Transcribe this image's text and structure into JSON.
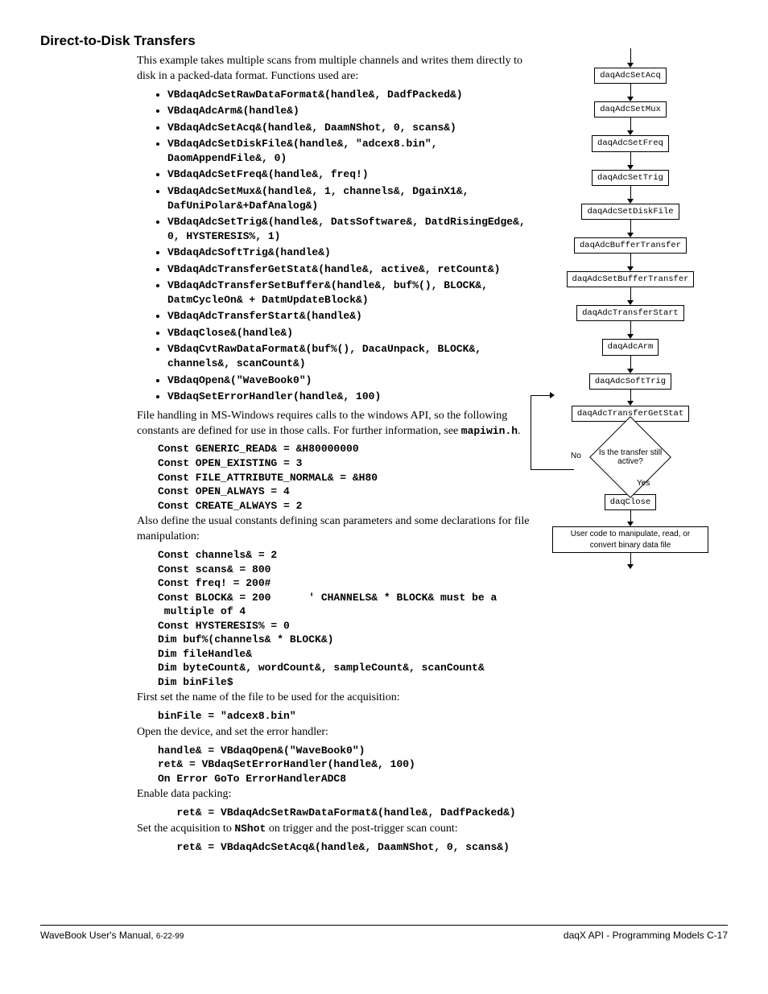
{
  "section_title": "Direct-to-Disk Transfers",
  "intro": "This example takes multiple scans from multiple channels and writes them directly to disk in a packed-data format.  Functions used are:",
  "functions": [
    "VBdaqAdcSetRawDataFormat&(handle&, DadfPacked&)",
    "VBdaqAdcArm&(handle&)",
    "VBdaqAdcSetAcq&(handle&, DaamNShot, 0, scans&)",
    "VBdaqAdcSetDiskFile&(handle&, \"adcex8.bin\", DaomAppendFile&, 0)",
    "VBdaqAdcSetFreq&(handle&, freq!)",
    "VBdaqAdcSetMux&(handle&, 1, channels&, DgainX1&, DafUniPolar&+DafAnalog&)",
    "VBdaqAdcSetTrig&(handle&, DatsSoftware&, DatdRisingEdge&, 0, HYSTERESIS%, 1)",
    "VBdaqAdcSoftTrig&(handle&)",
    "VBdaqAdcTransferGetStat&(handle&, active&, retCount&)",
    "VBdaqAdcTransferSetBuffer&(handle&, buf%(), BLOCK&, DatmCycleOn& + DatmUpdateBlock&)",
    "VBdaqAdcTransferStart&(handle&)",
    "VBdaqClose&(handle&)",
    "VBdaqCvtRawDataFormat&(buf%(), DacaUnpack, BLOCK&, channels&, scanCount&)",
    "VBdaqOpen&(\"WaveBook0\")",
    "VBdaqSetErrorHandler(handle&, 100)"
  ],
  "para_filehandling_a": "File handling in MS-Windows requires calls to the windows API, so the following constants are defined for use in those calls.  For further information, see ",
  "mapiwin": "mapiwin.h",
  "code_consts1": "Const GENERIC_READ& = &H80000000\nConst OPEN_EXISTING = 3\nConst FILE_ATTRIBUTE_NORMAL& = &H80\nConst OPEN_ALWAYS = 4\nConst CREATE_ALWAYS = 2",
  "para_also": "Also define the usual constants defining scan parameters and some declarations for file manipulation:",
  "code_consts2": "Const channels& = 2\nConst scans& = 800\nConst freq! = 200#\nConst BLOCK& = 200      ' CHANNELS& * BLOCK& must be a\n multiple of 4\nConst HYSTERESIS% = 0\nDim buf%(channels& * BLOCK&)\nDim fileHandle&\nDim byteCount&, wordCount&, sampleCount&, scanCount&\nDim binFile$",
  "para_firstset": "First set the name of the file to be used for the acquisition:",
  "code_binfile": "binFile = \"adcex8.bin\"",
  "para_open": "Open the device, and set the error handler:",
  "code_open": "handle& = VBdaqOpen&(\"WaveBook0\")\nret& = VBdaqSetErrorHandler(handle&, 100)\nOn Error GoTo ErrorHandlerADC8",
  "para_enable": "Enable data packing:",
  "code_enable": "   ret& = VBdaqAdcSetRawDataFormat&(handle&, DadfPacked&)",
  "para_setacq_a": "Set the acquisition to ",
  "nshot": "NShot",
  "para_setacq_b": " on trigger and the post-trigger scan count:",
  "code_setacq": "   ret& = VBdaqAdcSetAcq&(handle&, DaamNShot, 0, scans&)",
  "flow": {
    "boxes": [
      "daqAdcSetAcq",
      "daqAdcSetMux",
      "daqAdcSetFreq",
      "daqAdcSetTrig",
      "daqAdcSetDiskFile",
      "daqAdcBufferTransfer",
      "daqAdcSetBufferTransfer",
      "daqAdcTransferStart",
      "daqAdcArm",
      "daqAdcSoftTrig",
      "daqAdcTransferGetStat"
    ],
    "decision": "Is the transfer still active?",
    "yes": "Yes",
    "no": "No",
    "after_yes": "daqClose",
    "final": "User code to manipulate, read, or convert binary data file"
  },
  "footer": {
    "left_a": "WaveBook User's Manual, ",
    "left_b": "6-22-99",
    "right": "daqX API - Programming Models    C-17"
  }
}
